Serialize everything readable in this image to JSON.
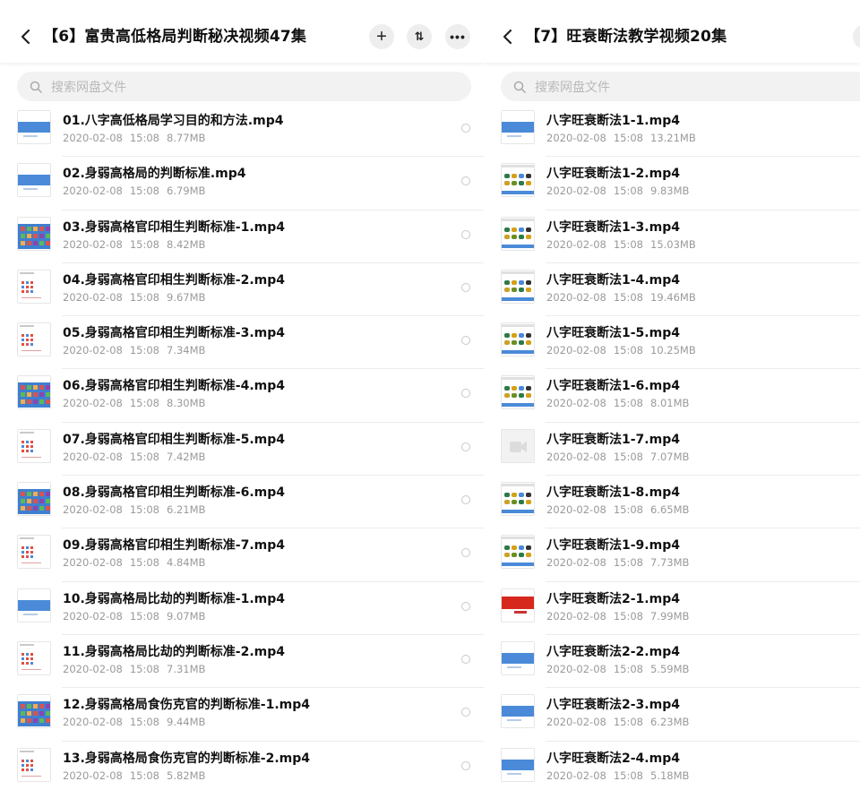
{
  "colors": {
    "accent": "#3b7fd6",
    "text": "#111111",
    "meta": "#9a9a9a",
    "search_bg": "#f2f2f2",
    "placeholder": "#b9b9b9"
  },
  "left": {
    "title": "【6】富贵高低格局判断秘决视频47集",
    "search_placeholder": "搜索网盘文件",
    "icons": {
      "back": "chevron-left-icon",
      "add": "plus-icon",
      "sort": "sort-icon",
      "more": "more-icon",
      "search": "search-icon"
    },
    "files": [
      {
        "name": "01.八字高低格局学习目的和方法.mp4",
        "date": "2020-02-08",
        "time": "15:08",
        "size": "8.77MB",
        "thumb": "blue"
      },
      {
        "name": "02.身弱高格局的判断标准.mp4",
        "date": "2020-02-08",
        "time": "15:08",
        "size": "6.79MB",
        "thumb": "blue"
      },
      {
        "name": "03.身弱高格官印相生判断标准-1.mp4",
        "date": "2020-02-08",
        "time": "15:08",
        "size": "8.42MB",
        "thumb": "grid"
      },
      {
        "name": "04.身弱高格官印相生判断标准-2.mp4",
        "date": "2020-02-08",
        "time": "15:08",
        "size": "9.67MB",
        "thumb": "white"
      },
      {
        "name": "05.身弱高格官印相生判断标准-3.mp4",
        "date": "2020-02-08",
        "time": "15:08",
        "size": "7.34MB",
        "thumb": "white"
      },
      {
        "name": "06.身弱高格官印相生判断标准-4.mp4",
        "date": "2020-02-08",
        "time": "15:08",
        "size": "8.30MB",
        "thumb": "grid"
      },
      {
        "name": "07.身弱高格官印相生判断标准-5.mp4",
        "date": "2020-02-08",
        "time": "15:08",
        "size": "7.42MB",
        "thumb": "white"
      },
      {
        "name": "08.身弱高格官印相生判断标准-6.mp4",
        "date": "2020-02-08",
        "time": "15:08",
        "size": "6.21MB",
        "thumb": "grid"
      },
      {
        "name": "09.身弱高格官印相生判断标准-7.mp4",
        "date": "2020-02-08",
        "time": "15:08",
        "size": "4.84MB",
        "thumb": "white"
      },
      {
        "name": "10.身弱高格局比劫的判断标准-1.mp4",
        "date": "2020-02-08",
        "time": "15:08",
        "size": "9.07MB",
        "thumb": "blue"
      },
      {
        "name": "11.身弱高格局比劫的判断标准-2.mp4",
        "date": "2020-02-08",
        "time": "15:08",
        "size": "7.31MB",
        "thumb": "white"
      },
      {
        "name": "12.身弱高格局食伤克官的判断标准-1.mp4",
        "date": "2020-02-08",
        "time": "15:08",
        "size": "9.44MB",
        "thumb": "grid"
      },
      {
        "name": "13.身弱高格局食伤克官的判断标准-2.mp4",
        "date": "2020-02-08",
        "time": "15:08",
        "size": "5.82MB",
        "thumb": "white"
      }
    ]
  },
  "right": {
    "title": "【7】旺衰断法教学视频20集",
    "search_placeholder": "搜索网盘文件",
    "icons": {
      "back": "chevron-left-icon",
      "search": "search-icon"
    },
    "files": [
      {
        "name": "八字旺衰断法1-1.mp4",
        "date": "2020-02-08",
        "time": "15:08",
        "size": "13.21MB",
        "thumb": "blue"
      },
      {
        "name": "八字旺衰断法1-2.mp4",
        "date": "2020-02-08",
        "time": "15:08",
        "size": "9.83MB",
        "thumb": "dots"
      },
      {
        "name": "八字旺衰断法1-3.mp4",
        "date": "2020-02-08",
        "time": "15:08",
        "size": "15.03MB",
        "thumb": "dots"
      },
      {
        "name": "八字旺衰断法1-4.mp4",
        "date": "2020-02-08",
        "time": "15:08",
        "size": "19.46MB",
        "thumb": "dots"
      },
      {
        "name": "八字旺衰断法1-5.mp4",
        "date": "2020-02-08",
        "time": "15:08",
        "size": "10.25MB",
        "thumb": "dots"
      },
      {
        "name": "八字旺衰断法1-6.mp4",
        "date": "2020-02-08",
        "time": "15:08",
        "size": "8.01MB",
        "thumb": "dots"
      },
      {
        "name": "八字旺衰断法1-7.mp4",
        "date": "2020-02-08",
        "time": "15:08",
        "size": "7.07MB",
        "thumb": "video"
      },
      {
        "name": "八字旺衰断法1-8.mp4",
        "date": "2020-02-08",
        "time": "15:08",
        "size": "6.65MB",
        "thumb": "dots"
      },
      {
        "name": "八字旺衰断法1-9.mp4",
        "date": "2020-02-08",
        "time": "15:08",
        "size": "7.73MB",
        "thumb": "dots"
      },
      {
        "name": "八字旺衰断法2-1.mp4",
        "date": "2020-02-08",
        "time": "15:08",
        "size": "7.99MB",
        "thumb": "red"
      },
      {
        "name": "八字旺衰断法2-2.mp4",
        "date": "2020-02-08",
        "time": "15:08",
        "size": "5.59MB",
        "thumb": "blue"
      },
      {
        "name": "八字旺衰断法2-3.mp4",
        "date": "2020-02-08",
        "time": "15:08",
        "size": "6.23MB",
        "thumb": "blue"
      },
      {
        "name": "八字旺衰断法2-4.mp4",
        "date": "2020-02-08",
        "time": "15:08",
        "size": "5.18MB",
        "thumb": "blue"
      }
    ]
  }
}
